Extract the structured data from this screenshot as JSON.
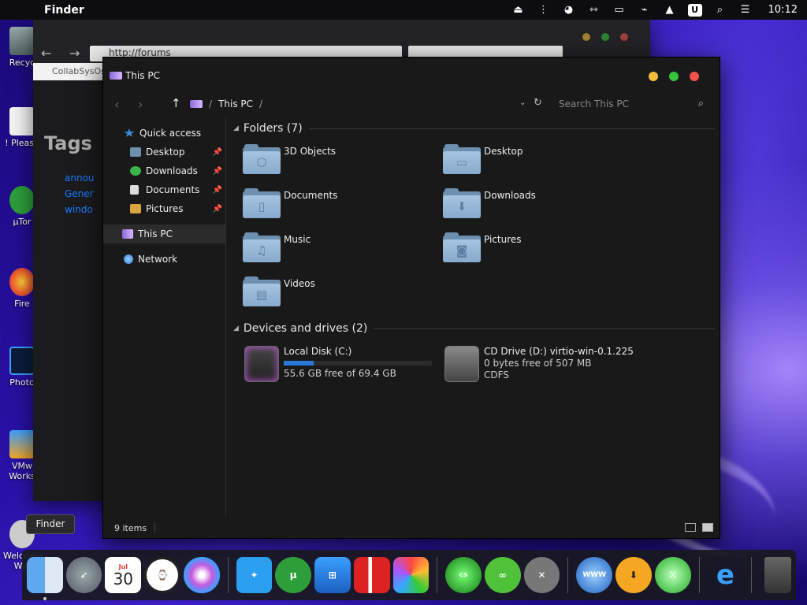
{
  "menubar": {
    "app_name": "Finder",
    "clock": "10:12",
    "tray_icons": [
      "eject-icon",
      "usb-icon",
      "pie-icon",
      "network-icon",
      "display-icon",
      "mute-icon",
      "upload-icon",
      "user-icon",
      "search-icon",
      "control-center-icon"
    ]
  },
  "desktop": {
    "icons": [
      {
        "label": "Recyc",
        "icon": "recycle-bin-icon"
      },
      {
        "label": "! Please",
        "icon": "notepad-icon"
      },
      {
        "label": "µTor",
        "icon": "utorrent-icon"
      },
      {
        "label": "Fire",
        "icon": "firefox-icon"
      },
      {
        "label": "Photo",
        "icon": "photoshop-icon"
      },
      {
        "label": "VMw Works",
        "icon": "vmware-icon"
      },
      {
        "label": "Welcome Win",
        "icon": "welcome-icon"
      }
    ]
  },
  "bg_browser": {
    "address": "http://forums",
    "tab_title": "CollabSysOs",
    "heading": "Tags",
    "links": [
      "annou",
      "Gener",
      "windo"
    ]
  },
  "finder": {
    "title": "This PC",
    "breadcrumb": "This PC",
    "search_placeholder": "Search This PC",
    "sidebar": {
      "items": [
        {
          "label": "Quick access",
          "pinned": false,
          "color": "#3a8dde"
        },
        {
          "label": "Desktop",
          "pinned": true,
          "color": "#6d8fb0"
        },
        {
          "label": "Downloads",
          "pinned": true,
          "color": "#3bb54a"
        },
        {
          "label": "Documents",
          "pinned": true,
          "color": "#dddddd"
        },
        {
          "label": "Pictures",
          "pinned": true,
          "color": "#d9a441"
        },
        {
          "label": "This PC",
          "pinned": false,
          "selected": true,
          "color": "#b9a7e6"
        },
        {
          "label": "Network",
          "pinned": false,
          "color": "#3a8dde"
        }
      ]
    },
    "folders_header": "Folders (7)",
    "folders": [
      {
        "name": "3D Objects",
        "glyph": "cube-icon"
      },
      {
        "name": "Desktop",
        "glyph": "desktop-icon"
      },
      {
        "name": "Documents",
        "glyph": "document-icon"
      },
      {
        "name": "Downloads",
        "glyph": "download-icon"
      },
      {
        "name": "Music",
        "glyph": "music-icon"
      },
      {
        "name": "Pictures",
        "glyph": "camera-icon"
      },
      {
        "name": "Videos",
        "glyph": "film-icon"
      }
    ],
    "drives_header": "Devices and drives (2)",
    "drives": [
      {
        "name": "Local Disk (C:)",
        "detail": "55.6 GB free of 69.4 GB",
        "used_fraction": 0.2
      },
      {
        "name": "CD Drive (D:) virtio-win-0.1.225",
        "detail": "0 bytes free of 507 MB",
        "fs": "CDFS"
      }
    ],
    "status": "9 items"
  },
  "tooltip": "Finder",
  "dock": {
    "apps": [
      "finder",
      "launchpad",
      "calendar",
      "clock",
      "siri",
      "safari",
      "utorrent",
      "windows",
      "parallels",
      "photos",
      "collabsysos",
      "link",
      "utilities",
      "www",
      "downloader",
      "network",
      "internet-explorer",
      "trash"
    ],
    "calendar_month": "Jul",
    "calendar_day": "30"
  },
  "colors": {
    "accent": "#2a79d8",
    "traffic_yellow": "#f5bd3b",
    "traffic_green": "#37c33e",
    "traffic_red": "#f2524a"
  }
}
